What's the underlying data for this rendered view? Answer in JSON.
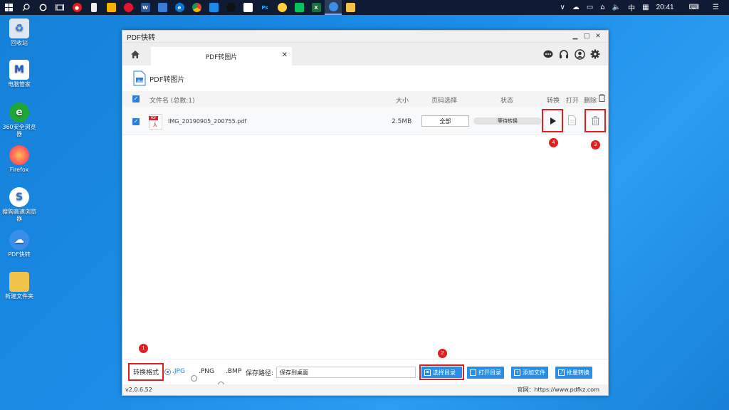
{
  "taskbar": {
    "clock": "20:41",
    "ime": "中",
    "apps": [
      "windows-logo",
      "search-icon",
      "task-view-icon",
      "widgets-icon",
      "netease-app",
      "phone-app",
      "qq-browser-app",
      "weibo-app",
      "word-app",
      "pen-app",
      "edge-app",
      "chrome-app",
      "photos-app",
      "qq-app",
      "media-app",
      "ps-app",
      "sticker-app",
      "wechat-app",
      "excel-app",
      "pdf-app",
      "explorer-app"
    ]
  },
  "desktop": {
    "icons": [
      {
        "label": "回收站",
        "icon": "recycle-bin-icon"
      },
      {
        "label": "电脑管家",
        "icon": "pc-manager-icon"
      },
      {
        "label": "360安全浏览器",
        "icon": "browser-360-icon"
      },
      {
        "label": "Firefox",
        "icon": "firefox-icon"
      },
      {
        "label": "搜狗高速浏览器",
        "icon": "sogou-browser-icon"
      },
      {
        "label": "PDF快转",
        "icon": "pdf-kuaizhuan-icon"
      },
      {
        "label": "新建文件夹",
        "icon": "folder-icon"
      }
    ]
  },
  "window": {
    "title": "PDF快转",
    "tab_label": "PDF转图片",
    "section_title": "PDF转图片",
    "columns": {
      "filename": "文件名 (总数:1)",
      "size": "大小",
      "page_select": "页码选择",
      "status": "状态",
      "convert": "转换",
      "open": "打开",
      "delete": "删除"
    },
    "rows": [
      {
        "filename": "IMG_20190905_200755.pdf",
        "size": "2.5MB",
        "pages": "全部",
        "status": "等待转换"
      }
    ],
    "annotations": [
      "1",
      "2",
      "3",
      "4"
    ],
    "bottom": {
      "format_label": "转换格式",
      "formats": [
        "JPG",
        "PNG",
        "BMP"
      ],
      "selected_format": "JPG",
      "save_path_label": "保存路径:",
      "save_path_value": "保存到桌面",
      "btn_choose_dir": "选择目录",
      "btn_open_dir": "打开目录",
      "btn_add_file": "添加文件",
      "btn_batch_convert": "批量转换"
    },
    "version": "v2.0.6.52",
    "website": "官网：https://www.pdfkz.com"
  },
  "colors": {
    "accent": "#2b8ee6",
    "highlight": "#e02020",
    "desktop": "#1a8be6"
  }
}
